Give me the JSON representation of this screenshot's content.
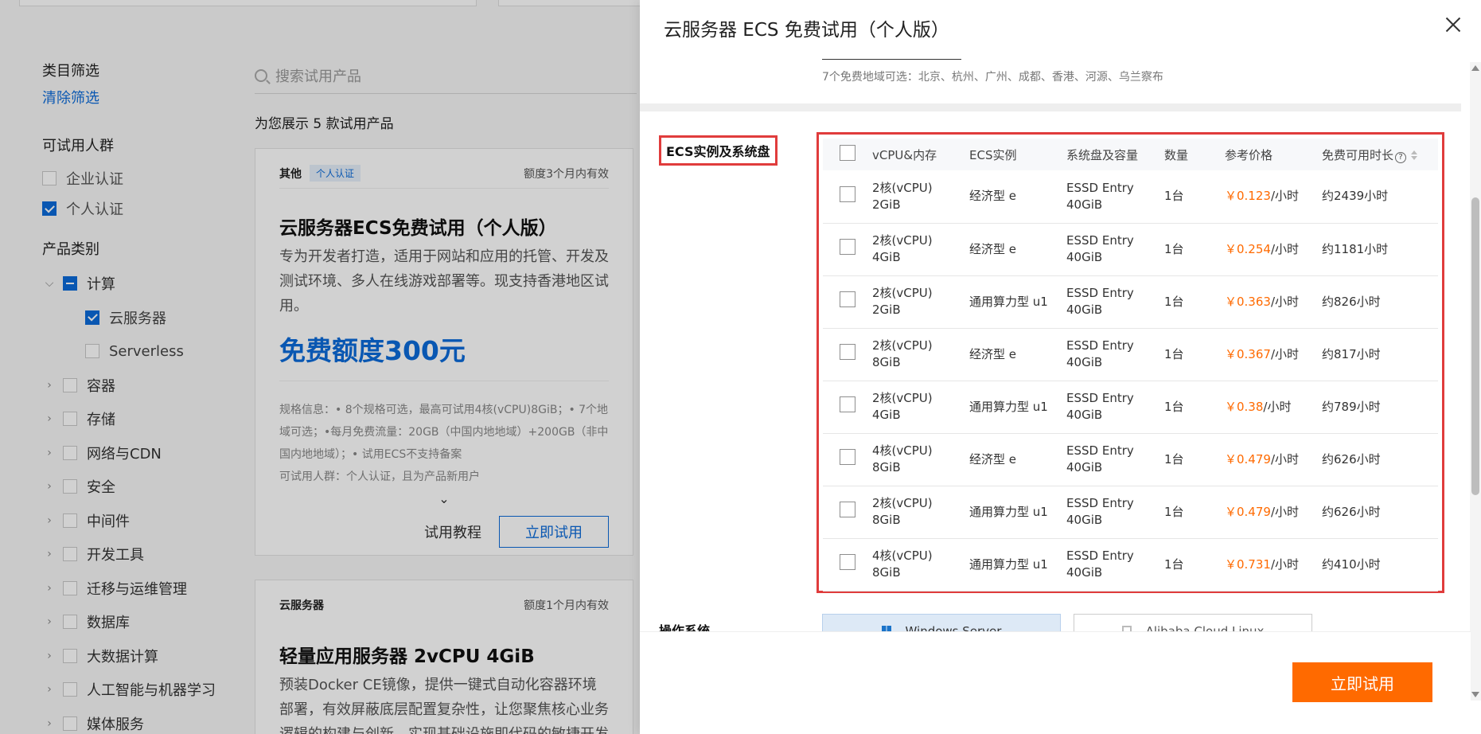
{
  "background": {
    "filter": {
      "title": "类目筛选",
      "clear": "清除筛选",
      "audience_title": "可试用人群",
      "audience": [
        {
          "label": "企业认证",
          "checked": false
        },
        {
          "label": "个人认证",
          "checked": true
        }
      ],
      "category_title": "产品类别",
      "categories": [
        {
          "label": "计算",
          "state": "partial",
          "expanded": true,
          "children": [
            {
              "label": "云服务器",
              "checked": true
            },
            {
              "label": "Serverless",
              "checked": false
            }
          ]
        },
        {
          "label": "容器"
        },
        {
          "label": "存储"
        },
        {
          "label": "网络与CDN"
        },
        {
          "label": "安全"
        },
        {
          "label": "中间件"
        },
        {
          "label": "开发工具"
        },
        {
          "label": "迁移与运维管理"
        },
        {
          "label": "数据库"
        },
        {
          "label": "大数据计算"
        },
        {
          "label": "人工智能与机器学习"
        },
        {
          "label": "媒体服务"
        }
      ]
    },
    "search": {
      "placeholder": "搜索试用产品"
    },
    "result_count": "为您展示 5 款试用产品",
    "cards": [
      {
        "category": "其他",
        "badge": "个人认证",
        "validity": "额度3个月内有效",
        "title": "云服务器ECS免费试用（个人版）",
        "description": "专为开发者打造，适用于网站和应用的托管、开发及测试环境、多人在线游戏部署等。现支持香港地区试用。",
        "free_quota": "免费额度300元",
        "spec": "规格信息：• 8个规格可选，最高可试用4核(vCPU)8GiB；• 7个地域可选；•每月免费流量：20GB（中国内地地域）+200GB（非中国内地地域）；• 试用ECS不支持备案",
        "audience": "可试用人群：个人认证，且为产品新用户",
        "tutorial": "试用教程",
        "try": "立即试用"
      },
      {
        "category": "云服务器",
        "validity": "额度1个月内有效",
        "title": "轻量应用服务器 2vCPU 4GiB",
        "description": "预装Docker CE镜像，提供一键式自动化容器环境部署，有效屏蔽底层配置复杂性，让您聚焦核心业务逻辑的构建与创新，实现基础设施即代码的敏捷开发"
      }
    ]
  },
  "drawer": {
    "title": "云服务器 ECS 免费试用（个人版）",
    "regions": "7个免费地域可选：北京、杭州、广州、成都、香港、河源、乌兰察布",
    "ecs_label": "ECS实例及系统盘",
    "table": {
      "headers": [
        "vCPU&内存",
        "ECS实例",
        "系统盘及容量",
        "数量",
        "参考价格",
        "免费可用时长"
      ],
      "rows": [
        {
          "cpu": "2核(vCPU)",
          "mem": "2GiB",
          "instance": "经济型 e",
          "disk": "ESSD Entry",
          "size": "40GiB",
          "qty": "1台",
          "price": "￥0.123",
          "unit": "/小时",
          "duration": "约2439小时"
        },
        {
          "cpu": "2核(vCPU)",
          "mem": "4GiB",
          "instance": "经济型 e",
          "disk": "ESSD Entry",
          "size": "40GiB",
          "qty": "1台",
          "price": "￥0.254",
          "unit": "/小时",
          "duration": "约1181小时"
        },
        {
          "cpu": "2核(vCPU)",
          "mem": "2GiB",
          "instance": "通用算力型 u1",
          "disk": "ESSD Entry",
          "size": "40GiB",
          "qty": "1台",
          "price": "￥0.363",
          "unit": "/小时",
          "duration": "约826小时"
        },
        {
          "cpu": "2核(vCPU)",
          "mem": "8GiB",
          "instance": "经济型 e",
          "disk": "ESSD Entry",
          "size": "40GiB",
          "qty": "1台",
          "price": "￥0.367",
          "unit": "/小时",
          "duration": "约817小时"
        },
        {
          "cpu": "2核(vCPU)",
          "mem": "4GiB",
          "instance": "通用算力型 u1",
          "disk": "ESSD Entry",
          "size": "40GiB",
          "qty": "1台",
          "price": "￥0.38",
          "unit": "/小时",
          "duration": "约789小时"
        },
        {
          "cpu": "4核(vCPU)",
          "mem": "8GiB",
          "instance": "经济型 e",
          "disk": "ESSD Entry",
          "size": "40GiB",
          "qty": "1台",
          "price": "￥0.479",
          "unit": "/小时",
          "duration": "约626小时"
        },
        {
          "cpu": "2核(vCPU)",
          "mem": "8GiB",
          "instance": "通用算力型 u1",
          "disk": "ESSD Entry",
          "size": "40GiB",
          "qty": "1台",
          "price": "￥0.479",
          "unit": "/小时",
          "duration": "约626小时"
        },
        {
          "cpu": "4核(vCPU)",
          "mem": "8GiB",
          "instance": "通用算力型 u1",
          "disk": "ESSD Entry",
          "size": "40GiB",
          "qty": "1台",
          "price": "￥0.731",
          "unit": "/小时",
          "duration": "约410小时"
        }
      ]
    },
    "os_label": "操作系统",
    "os_options": [
      "Windows Server",
      "Alibaba Cloud Linux"
    ],
    "submit": "立即试用"
  },
  "colors": {
    "accent": "#0b6bd9",
    "price": "#ff6a00",
    "highlight": "#e03c3c",
    "primary_button": "#ff6a00"
  }
}
